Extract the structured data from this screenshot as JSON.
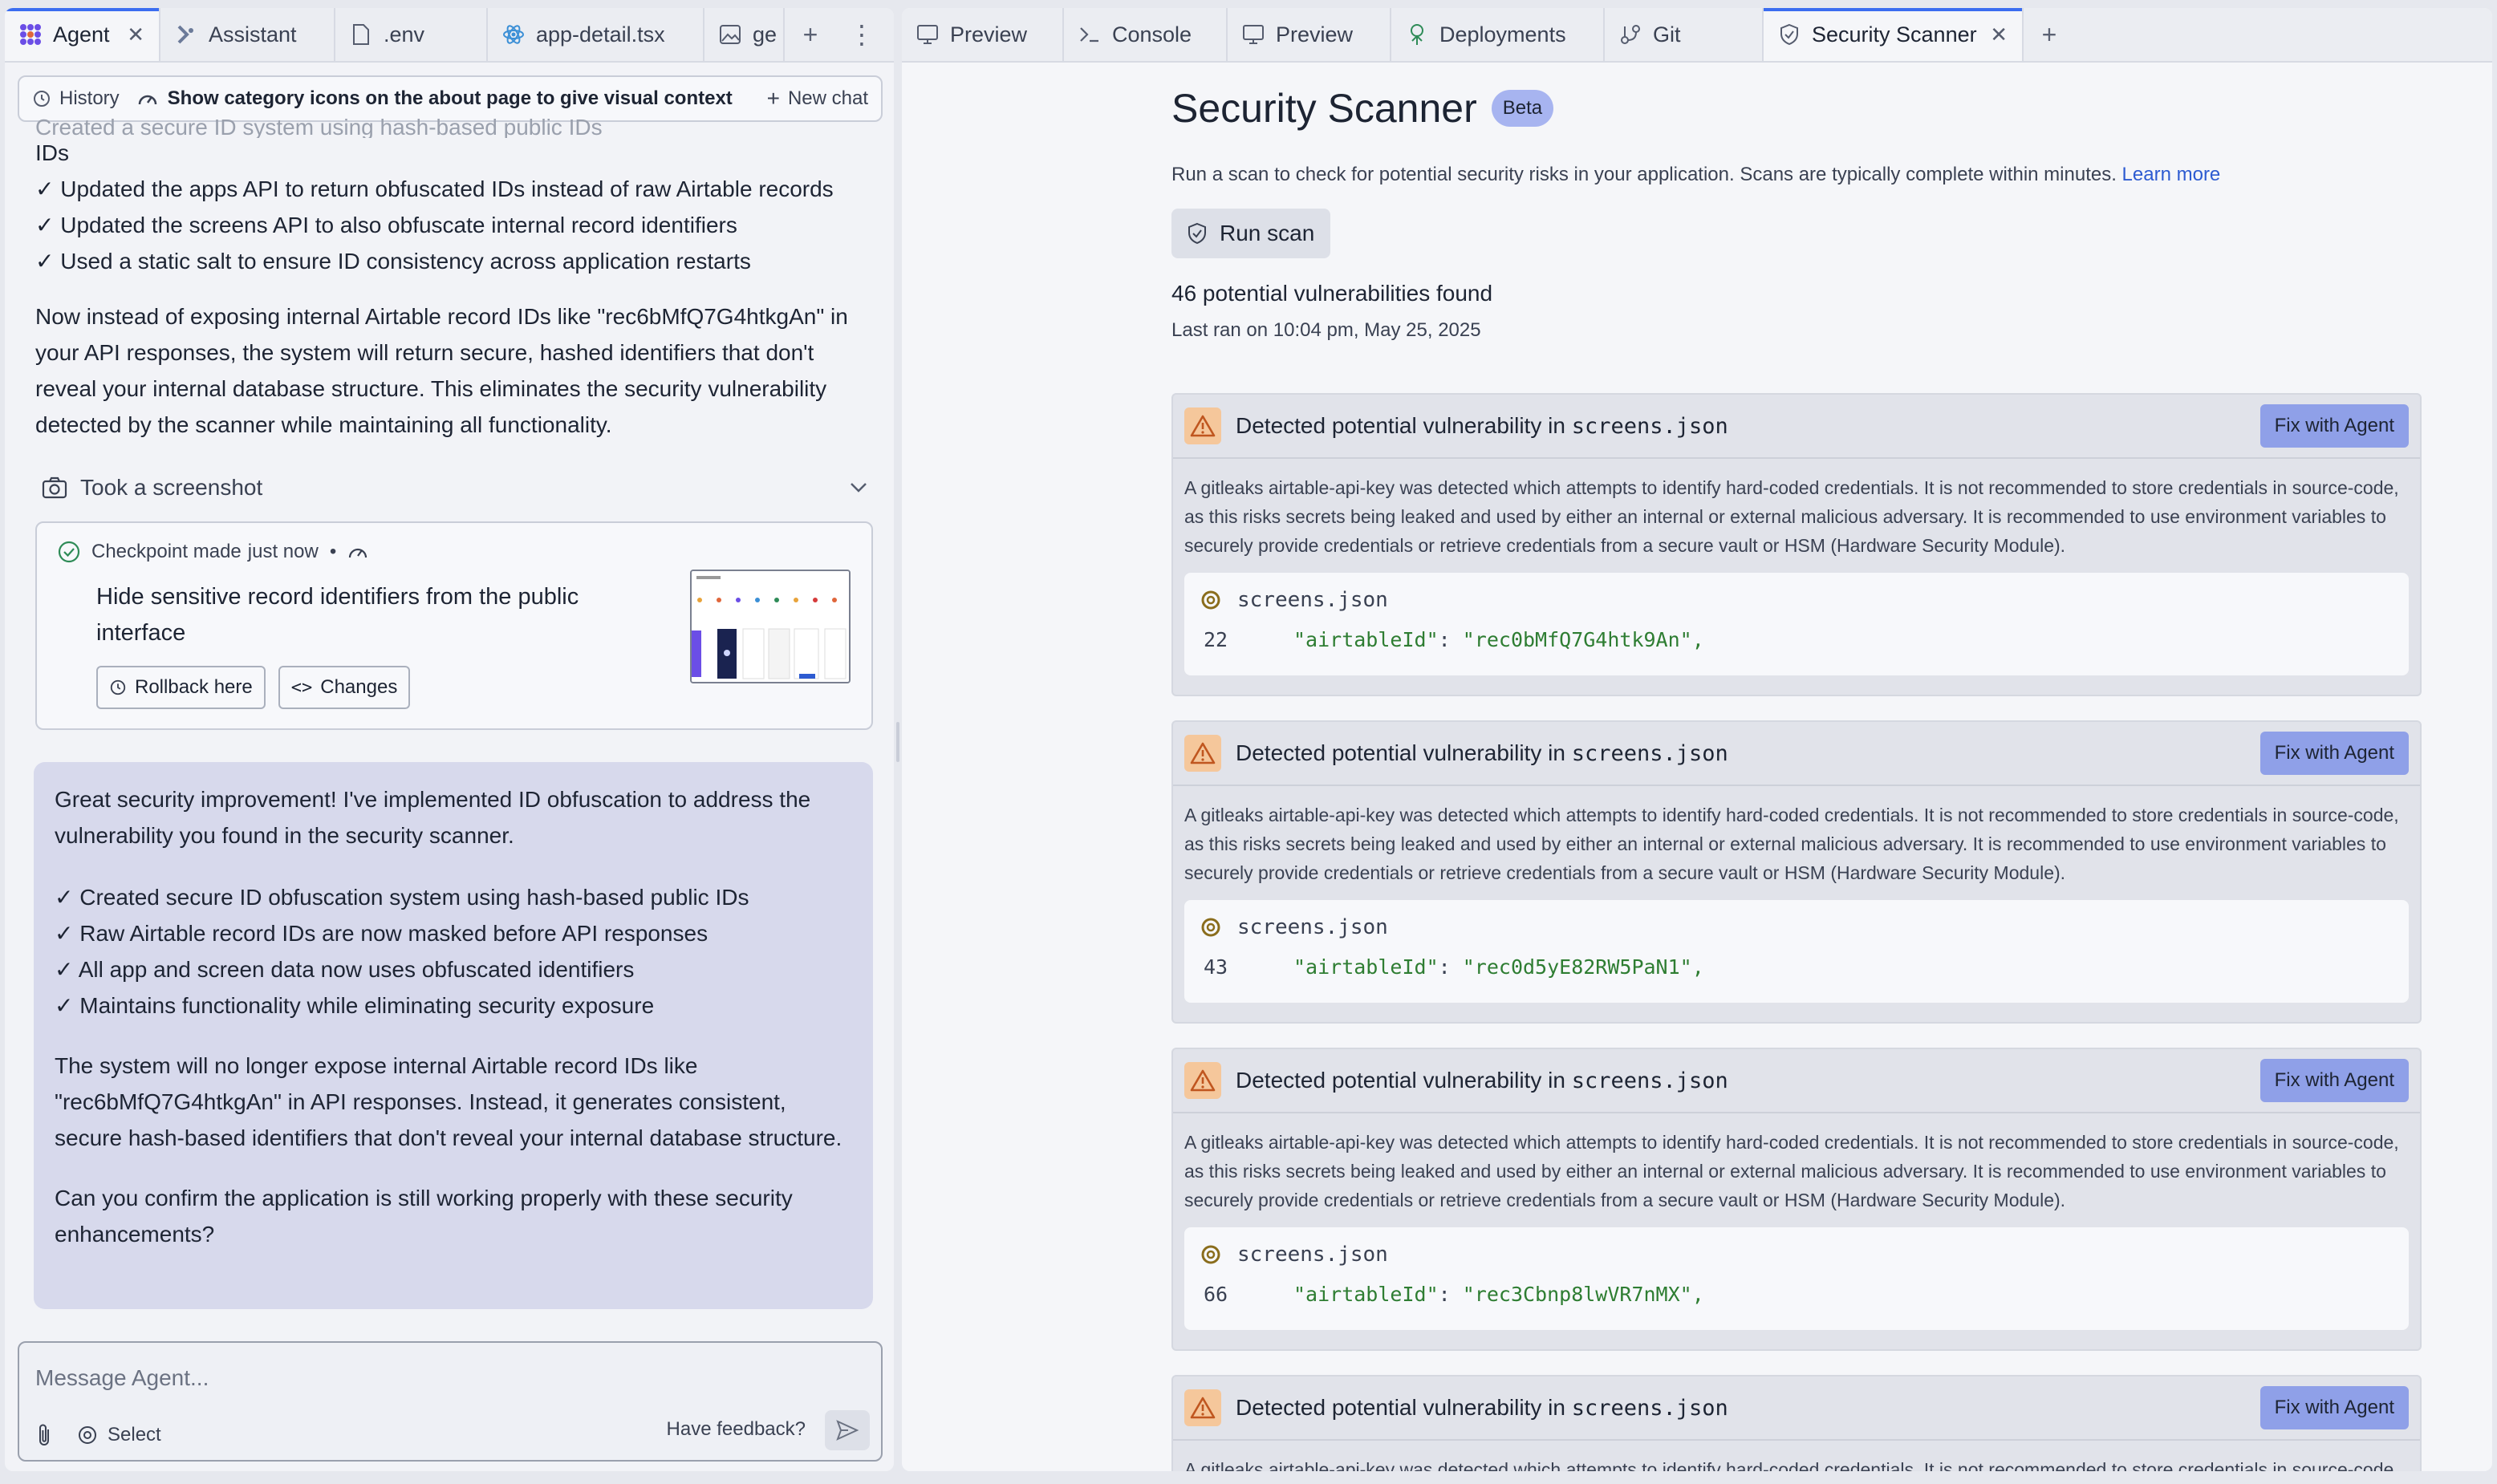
{
  "left_tabs": [
    {
      "label": "Agent",
      "icon": "agent-icon",
      "active": true,
      "closable": true
    },
    {
      "label": "Assistant",
      "icon": "assistant-icon"
    },
    {
      "label": ".env",
      "icon": "file-icon"
    },
    {
      "label": "app-detail.tsx",
      "icon": "react-icon"
    },
    {
      "label": "ge",
      "icon": "image-icon"
    }
  ],
  "right_tabs": [
    {
      "label": "Preview",
      "icon": "monitor-icon"
    },
    {
      "label": "Console",
      "icon": "terminal-icon"
    },
    {
      "label": "Preview",
      "icon": "monitor-icon"
    },
    {
      "label": "Deployments",
      "icon": "deploy-icon"
    },
    {
      "label": "Git",
      "icon": "git-icon"
    },
    {
      "label": "Security Scanner",
      "icon": "shield-icon",
      "active": true,
      "closable": true
    }
  ],
  "chat_topbar": {
    "history": "History",
    "topic": "Show category icons on the about page to give visual context",
    "new_chat": "New chat"
  },
  "chat": {
    "faded_line": "Created a secure ID system using hash-based public IDs",
    "ids_word": "IDs",
    "bullets1": [
      "✓ Updated the apps API to return obfuscated IDs instead of raw Airtable records",
      "✓ Updated the screens API to also obfuscate internal record identifiers",
      "✓ Used a static salt to ensure ID consistency across application restarts"
    ],
    "para1": "Now instead of exposing internal Airtable record IDs like \"rec6bMfQ7G4htkgAn\" in your API responses, the system will return secure, hashed identifiers that don't reveal your internal database structure. This eliminates the security vulnerability detected by the scanner while maintaining all functionality.",
    "screenshot_label": "Took a screenshot"
  },
  "checkpoint": {
    "meta_prefix": "Checkpoint made",
    "meta_time": "just now",
    "title": "Hide sensitive record identifiers from the public interface",
    "rollback": "Rollback here",
    "changes": "Changes"
  },
  "agent_message": {
    "intro": "Great security improvement! I've implemented ID obfuscation to address the vulnerability you found in the security scanner.",
    "bullets": [
      "✓ Created secure ID obfuscation system using hash-based public IDs",
      "✓ Raw Airtable record IDs are now masked before API responses",
      "✓ All app and screen data now uses obfuscated identifiers",
      "✓ Maintains functionality while eliminating security exposure"
    ],
    "para": "The system will no longer expose internal Airtable record IDs like \"rec6bMfQ7G4htkgAn\" in API responses. Instead, it generates consistent, secure hash-based identifiers that don't reveal your internal database structure.",
    "question": "Can you confirm the application is still working properly with these security enhancements?"
  },
  "composer": {
    "placeholder": "Message Agent...",
    "select": "Select",
    "feedback": "Have feedback?"
  },
  "scanner": {
    "title": "Security Scanner",
    "badge": "Beta",
    "description": "Run a scan to check for potential security risks in your application. Scans are typically complete within minutes.",
    "learn_more": "Learn more",
    "run_scan": "Run scan",
    "found": "46 potential vulnerabilities found",
    "last_ran": "Last ran on 10:04 pm, May 25, 2025",
    "fix_label": "Fix with Agent",
    "vuln_prefix": "Detected potential vulnerability in",
    "vuln_desc": "A gitleaks airtable-api-key was detected which attempts to identify hard-coded credentials. It is not recommended to store credentials in source-code, as this risks secrets being leaked and used by either an internal or external malicious adversary. It is recommended to use environment variables to securely provide credentials or retrieve credentials from a secure vault or HSM (Hardware Security Module).",
    "findings": [
      {
        "file": "screens.json",
        "line": "22",
        "key": "\"airtableId\"",
        "value": "\"rec0bMfQ7G4htk9An\","
      },
      {
        "file": "screens.json",
        "line": "43",
        "key": "\"airtableId\"",
        "value": "\"rec0d5yE82RW5PaN1\","
      },
      {
        "file": "screens.json",
        "line": "66",
        "key": "\"airtableId\"",
        "value": "\"rec3Cbnp8lwVR7nMX\","
      },
      {
        "file": "screens.json"
      }
    ]
  },
  "colors": {
    "accent": "#3b6df0",
    "agent_bubble": "#d7d9ec",
    "fix_button": "#8fa0e8",
    "warning": "#f5c79b",
    "code_green": "#2e7d32"
  }
}
